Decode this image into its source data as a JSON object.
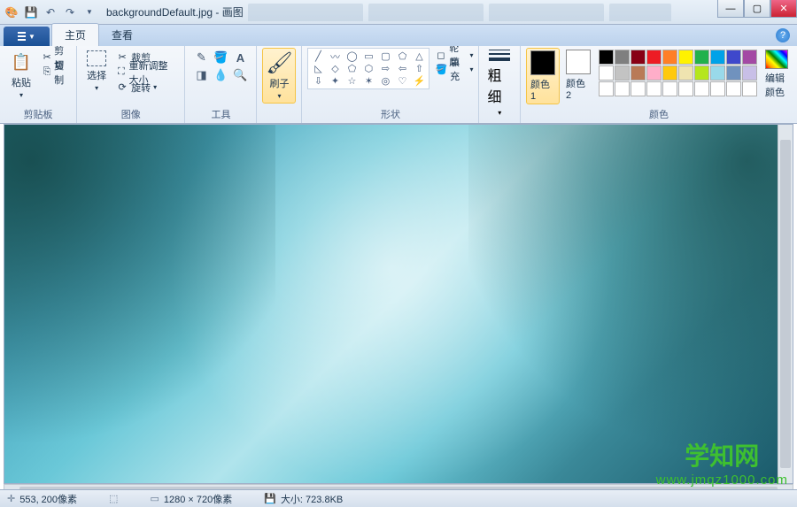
{
  "title": "backgroundDefault.jpg - 画图",
  "tabs": {
    "home": "主页",
    "view": "查看"
  },
  "groups": {
    "clipboard": {
      "label": "剪贴板",
      "paste": "粘贴",
      "cut": "剪切",
      "copy": "复制"
    },
    "image": {
      "label": "图像",
      "select": "选择",
      "crop": "裁剪",
      "resize": "重新调整大小",
      "rotate": "旋转"
    },
    "tools": {
      "label": "工具"
    },
    "brushes": {
      "label": "刷子"
    },
    "shapes": {
      "label": "形状",
      "outline": "轮廓",
      "fill": "填充"
    },
    "size": {
      "label": "粗细"
    },
    "colors": {
      "label": "颜色",
      "color1": "颜色 1",
      "color2": "颜色 2",
      "edit": "编辑颜色"
    }
  },
  "palette_row1": [
    "#000000",
    "#7f7f7f",
    "#880015",
    "#ed1c24",
    "#ff7f27",
    "#fff200",
    "#22b14c",
    "#00a2e8",
    "#3f48cc",
    "#a349a4"
  ],
  "palette_row2": [
    "#ffffff",
    "#c3c3c3",
    "#b97a57",
    "#ffaec9",
    "#ffc90e",
    "#efe4b0",
    "#b5e61d",
    "#99d9ea",
    "#7092be",
    "#c8bfe7"
  ],
  "palette_row3": [
    "#ffffff",
    "#ffffff",
    "#ffffff",
    "#ffffff",
    "#ffffff",
    "#ffffff",
    "#ffffff",
    "#ffffff",
    "#ffffff",
    "#ffffff"
  ],
  "color1": "#000000",
  "color2": "#ffffff",
  "status": {
    "pos": "553, 200像素",
    "dim": "1280 × 720像素",
    "size": "大小: 723.8KB"
  },
  "watermark": {
    "line1": "学知网",
    "line2": "www.jmqz1000.com"
  }
}
